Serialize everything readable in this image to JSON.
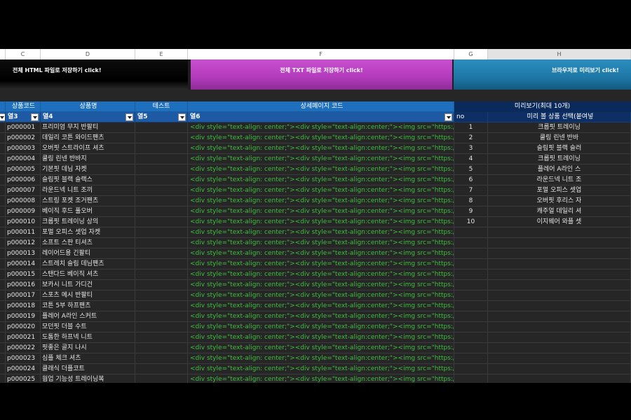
{
  "columns": [
    "C",
    "D",
    "E",
    "F",
    "G",
    "H"
  ],
  "buttons": {
    "html": "전체 HTML 파일로 저장하기 click!",
    "txt": "전체 TXT 파일로 저장하기 click!",
    "preview": "브라우저로 미리보기 click!"
  },
  "header1": {
    "code": "상품코드",
    "name": "상품명",
    "test": "테스트",
    "detail": "상세페이지 코드",
    "preview_title": "미리보기(최대 10개)"
  },
  "header2": {
    "col3": "열3",
    "col4": "열4",
    "col5": "열5",
    "col6": "열6",
    "no": "no",
    "select": "미리 볼 상품 선택(붙여넣"
  },
  "code_snippet": "<div style=\"text-align: center;\"><div style=\"text-align:center;\"><img src=\"https:/",
  "rows": [
    {
      "code": "p000001",
      "name": "프리미엄 무지 반팔티"
    },
    {
      "code": "p000002",
      "name": "데일리 코튼 와이드팬츠"
    },
    {
      "code": "p000003",
      "name": "오버핏 스트라이프 셔츠"
    },
    {
      "code": "p000004",
      "name": "쿨링 린넨 반바지"
    },
    {
      "code": "p000005",
      "name": "기본핏 데님 자켓"
    },
    {
      "code": "p000006",
      "name": "슬림핏 블랙 슬랙스"
    },
    {
      "code": "p000007",
      "name": "라운드넥 니트 조끼"
    },
    {
      "code": "p000008",
      "name": "스트링 포켓 조거팬츠"
    },
    {
      "code": "p000009",
      "name": "베이직 후드 풀오버"
    },
    {
      "code": "p000010",
      "name": "크롭핏 트레이닝 상의"
    },
    {
      "code": "p000011",
      "name": "포멀 오피스 셋업 자켓"
    },
    {
      "code": "p000012",
      "name": "소프트 스판 티셔츠"
    },
    {
      "code": "p000013",
      "name": "레이어드용 긴팔티"
    },
    {
      "code": "p000014",
      "name": "스트레치 슬림 데님팬츠"
    },
    {
      "code": "p000015",
      "name": "스탠다드 베이직 셔츠"
    },
    {
      "code": "p000016",
      "name": "보카시 니트 가디건"
    },
    {
      "code": "p000017",
      "name": "스포츠 메시 반팔티"
    },
    {
      "code": "p000018",
      "name": "코튼 5부 하프팬츠"
    },
    {
      "code": "p000019",
      "name": "플레어 A라인 스커트"
    },
    {
      "code": "p000020",
      "name": "모던핏 더블 수트"
    },
    {
      "code": "p000021",
      "name": "도톰한 하프넥 니트"
    },
    {
      "code": "p000022",
      "name": "핏좋은 골지 나시"
    },
    {
      "code": "p000023",
      "name": "심플 체크 셔츠"
    },
    {
      "code": "p000024",
      "name": "클래식 더플코트"
    },
    {
      "code": "p000025",
      "name": "웜업 기능성 트레이닝복"
    }
  ],
  "preview_list": [
    {
      "no": "1",
      "name": "크롭핏 트레이닝"
    },
    {
      "no": "2",
      "name": "쿨링 린넨 반바"
    },
    {
      "no": "3",
      "name": "슬림핏 블랙 슬러"
    },
    {
      "no": "4",
      "name": "크롭핏 트레이닝"
    },
    {
      "no": "5",
      "name": "플레어 A라인 스"
    },
    {
      "no": "6",
      "name": "라운드넥 니트 조"
    },
    {
      "no": "7",
      "name": "포멀 오피스 셋업"
    },
    {
      "no": "8",
      "name": "오버핏 후리스 자"
    },
    {
      "no": "9",
      "name": "캐주얼 데일리 셔"
    },
    {
      "no": "10",
      "name": "이지웨어 와플 셋"
    }
  ]
}
